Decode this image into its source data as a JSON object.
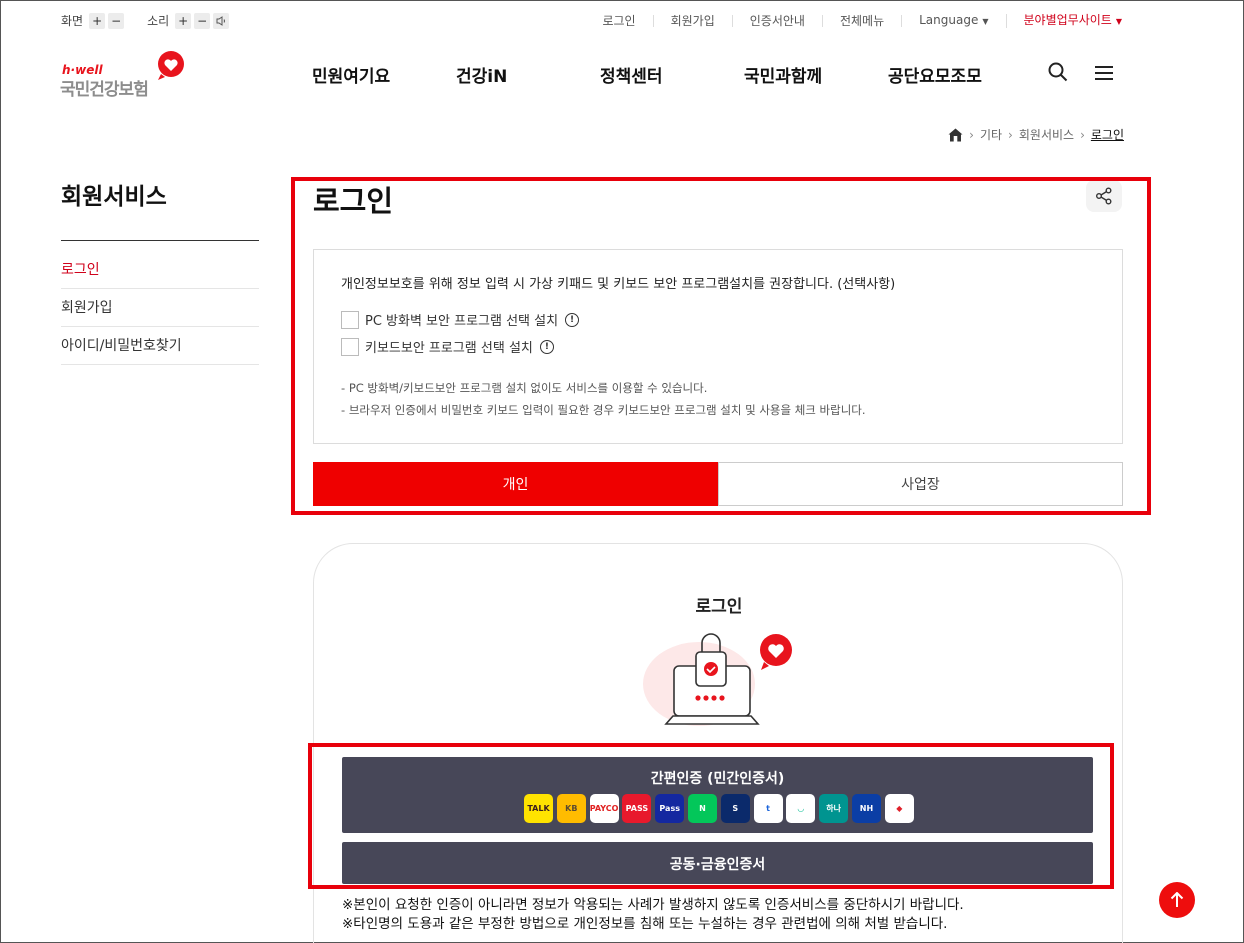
{
  "utility": {
    "screen_label": "화면",
    "sound_label": "소리",
    "plus": "+",
    "minus": "−",
    "links": [
      "로그인",
      "회원가입",
      "인증서안내",
      "전체메뉴",
      "Language",
      "분야별업무사이트"
    ]
  },
  "logo": {
    "en": "h·well",
    "kr": "국민건강보험"
  },
  "gnb": [
    "민원여기요",
    "건강iN",
    "정책센터",
    "국민과함께",
    "공단요모조모"
  ],
  "breadcrumb": [
    "기타",
    "회원서비스",
    "로그인"
  ],
  "sidebar": {
    "title": "회원서비스",
    "items": [
      {
        "label": "로그인",
        "active": true
      },
      {
        "label": "회원가입",
        "active": false
      },
      {
        "label": "아이디/비밀번호찾기",
        "active": false
      }
    ]
  },
  "page_title": "로그인",
  "notice": {
    "headline": "개인정보보호를 위해 정보 입력 시 가상 키패드 및 키보드 보안 프로그램설치를 권장합니다. (선택사항)",
    "options": [
      "PC 방화벽 보안 프로그램 선택 설치",
      "키보드보안 프로그램 선택 설치"
    ],
    "bullets": [
      "PC 방화벽/키보드보안 프로그램 설치 없이도 서비스를 이용할 수 있습니다.",
      "브라우저 인증에서 비밀번호 키보드 입력이 필요한 경우 키보드보안 프로그램 설치 및 사용을 체크 바랍니다."
    ]
  },
  "tabs": [
    "개인",
    "사업장"
  ],
  "login_card": {
    "title": "로그인",
    "simple_auth_label": "간편인증 (민간인증서)",
    "public_auth_label": "공동·금융인증서",
    "providers": [
      {
        "name": "kakao-icon",
        "text": "TALK",
        "bg": "#ffe300",
        "fg": "#3a1d1d"
      },
      {
        "name": "kb-icon",
        "text": "KB",
        "bg": "#ffbc00",
        "fg": "#5a4a30"
      },
      {
        "name": "payco-icon",
        "text": "PAYCO",
        "bg": "#ffffff",
        "fg": "#e02020"
      },
      {
        "name": "pass-icon",
        "text": "PASS",
        "bg": "#e8192c",
        "fg": "#ffffff"
      },
      {
        "name": "samsung-pass-icon",
        "text": "Pass",
        "bg": "#1428a0",
        "fg": "#ffffff"
      },
      {
        "name": "naver-icon",
        "text": "N",
        "bg": "#03c75a",
        "fg": "#ffffff"
      },
      {
        "name": "shinhan-icon",
        "text": "S",
        "bg": "#0b2a6b",
        "fg": "#ffffff"
      },
      {
        "name": "toss-icon",
        "text": "t",
        "bg": "#ffffff",
        "fg": "#1b64da"
      },
      {
        "name": "banksalad-icon",
        "text": "◡",
        "bg": "#ffffff",
        "fg": "#18c29c"
      },
      {
        "name": "hana-icon",
        "text": "하나",
        "bg": "#009490",
        "fg": "#ffffff"
      },
      {
        "name": "nh-icon",
        "text": "NH",
        "bg": "#0b3ea5",
        "fg": "#ffffff"
      },
      {
        "name": "woori-icon",
        "text": "◆",
        "bg": "#ffffff",
        "fg": "#e0202a"
      }
    ]
  },
  "warnings": [
    "※본인이 요청한 인증이 아니라면 정보가 악용되는 사례가 발생하지 않도록 인증서비스를 중단하시기 바랍니다.",
    "※타인명의 도용과 같은 부정한 방법으로 개인정보를 침해 또는 누설하는 경우 관련법에 의해 처벌 받습니다."
  ],
  "colors": {
    "accent": "#ef0000",
    "button_dark": "#474758",
    "annotation": "#e8000b"
  }
}
